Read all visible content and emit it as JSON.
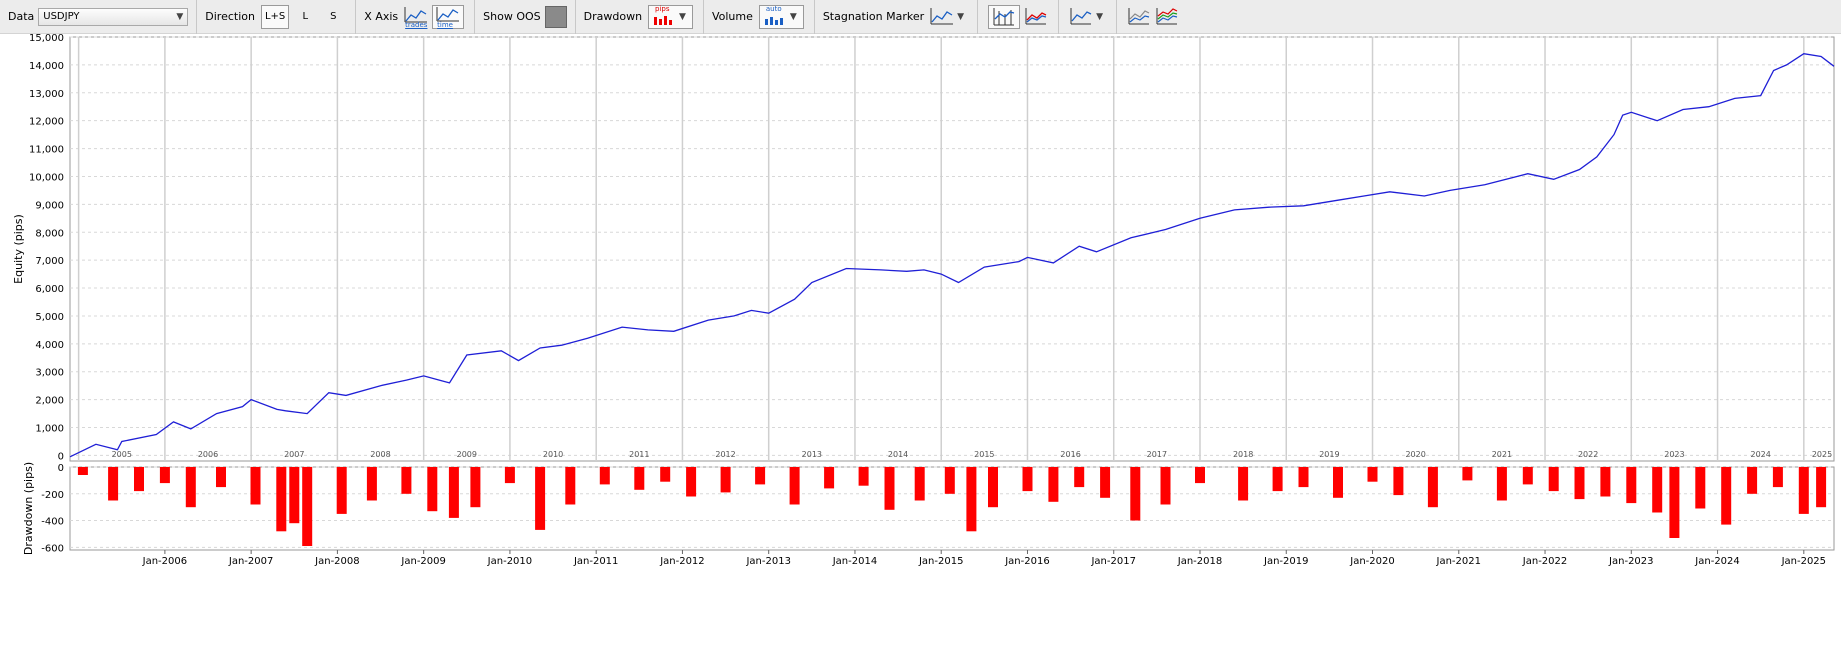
{
  "toolbar": {
    "data_label": "Data",
    "symbol": "USDJPY",
    "direction_label": "Direction",
    "direction_options": [
      "L+S",
      "L",
      "S"
    ],
    "xaxis_label": "X Axis",
    "xaxis_trades": "trades",
    "xaxis_time": "time",
    "showoos_label": "Show OOS",
    "drawdown_label": "Drawdown",
    "drawdown_unit": "pips",
    "volume_label": "Volume",
    "volume_mode": "auto",
    "stagnation_label": "Stagnation Marker"
  },
  "colors": {
    "equity": "#1f1fd6",
    "drawdown": "#ff0000",
    "grid": "#d8d8d8",
    "year_band": "#cfcfcf"
  },
  "chart_data": [
    {
      "type": "line",
      "ylabel": "Equity (pips)",
      "ylim": [
        -200,
        15000
      ],
      "yticks": [
        0,
        1000,
        2000,
        3000,
        4000,
        5000,
        6000,
        7000,
        8000,
        9000,
        10000,
        11000,
        12000,
        13000,
        14000,
        15000
      ],
      "ytick_labels": [
        "0",
        "1,000",
        "2,000",
        "3,000",
        "4,000",
        "5,000",
        "6,000",
        "7,000",
        "8,000",
        "9,000",
        "10,000",
        "11,000",
        "12,000",
        "13,000",
        "14,000",
        "15,000"
      ],
      "xlim": [
        2004.9,
        2025.35
      ],
      "year_labels": [
        "2005",
        "2006",
        "2007",
        "2008",
        "2009",
        "2010",
        "2011",
        "2012",
        "2013",
        "2014",
        "2015",
        "2016",
        "2017",
        "2018",
        "2019",
        "2020",
        "2021",
        "2022",
        "2023",
        "2024",
        "2025"
      ],
      "grid": true,
      "series": [
        {
          "x": [
            2004.9,
            2005.2,
            2005.45,
            2005.5,
            2005.9,
            2006.1,
            2006.3,
            2006.6,
            2006.9,
            2007.0,
            2007.3,
            2007.4,
            2007.65,
            2007.9,
            2008.1,
            2008.5,
            2008.8,
            2009.0,
            2009.3,
            2009.5,
            2009.9,
            2010.1,
            2010.35,
            2010.6,
            2010.9,
            2011.3,
            2011.6,
            2011.9,
            2012.3,
            2012.6,
            2012.8,
            2013.0,
            2013.3,
            2013.5,
            2013.9,
            2014.3,
            2014.6,
            2014.8,
            2015.0,
            2015.2,
            2015.5,
            2015.9,
            2016.0,
            2016.3,
            2016.6,
            2016.8,
            2017.2,
            2017.6,
            2018.0,
            2018.4,
            2018.8,
            2019.2,
            2019.6,
            2019.9,
            2020.2,
            2020.6,
            2020.9,
            2021.3,
            2021.8,
            2022.1,
            2022.4,
            2022.6,
            2022.8,
            2022.9,
            2023.0,
            2023.3,
            2023.6,
            2023.9,
            2024.2,
            2024.5,
            2024.65,
            2024.8,
            2025.0,
            2025.2,
            2025.35
          ],
          "y": [
            -50,
            400,
            200,
            500,
            750,
            1200,
            950,
            1500,
            1750,
            2000,
            1650,
            1600,
            1500,
            2250,
            2150,
            2500,
            2700,
            2850,
            2600,
            3600,
            3750,
            3400,
            3850,
            3950,
            4200,
            4600,
            4500,
            4450,
            4850,
            5000,
            5200,
            5100,
            5600,
            6200,
            6700,
            6650,
            6600,
            6650,
            6500,
            6200,
            6750,
            6950,
            7100,
            6900,
            7500,
            7300,
            7800,
            8100,
            8500,
            8800,
            8900,
            8950,
            9150,
            9300,
            9450,
            9300,
            9500,
            9700,
            10100,
            9900,
            10250,
            10700,
            11500,
            12200,
            12300,
            12000,
            12400,
            12500,
            12800,
            12900,
            13800,
            14000,
            14400,
            14300,
            13950
          ]
        }
      ]
    },
    {
      "type": "bar",
      "ylabel": "Drawdown (pips)",
      "ylim": [
        -620,
        0
      ],
      "yticks": [
        0,
        -200,
        -400,
        -600
      ],
      "ytick_labels": [
        "0",
        "-200",
        "-400",
        "-600"
      ],
      "x_tick_labels": [
        "Jan-2006",
        "Jan-2007",
        "Jan-2008",
        "Jan-2009",
        "Jan-2010",
        "Jan-2011",
        "Jan-2012",
        "Jan-2013",
        "Jan-2014",
        "Jan-2015",
        "Jan-2016",
        "Jan-2017",
        "Jan-2018",
        "Jan-2019",
        "Jan-2020",
        "Jan-2021",
        "Jan-2022",
        "Jan-2023",
        "Jan-2024",
        "Jan-2025"
      ],
      "grid": true,
      "series": [
        {
          "name": "Drawdown",
          "x": [
            2005.05,
            2005.4,
            2005.7,
            2006.0,
            2006.3,
            2006.65,
            2007.05,
            2007.35,
            2007.5,
            2007.65,
            2008.05,
            2008.4,
            2008.8,
            2009.1,
            2009.35,
            2009.6,
            2010.0,
            2010.35,
            2010.7,
            2011.1,
            2011.5,
            2011.8,
            2012.1,
            2012.5,
            2012.9,
            2013.3,
            2013.7,
            2014.1,
            2014.4,
            2014.75,
            2015.1,
            2015.35,
            2015.6,
            2016.0,
            2016.3,
            2016.6,
            2016.9,
            2017.25,
            2017.6,
            2018.0,
            2018.5,
            2018.9,
            2019.2,
            2019.6,
            2020.0,
            2020.3,
            2020.7,
            2021.1,
            2021.5,
            2021.8,
            2022.1,
            2022.4,
            2022.7,
            2023.0,
            2023.3,
            2023.5,
            2023.8,
            2024.1,
            2024.4,
            2024.7,
            2025.0,
            2025.2
          ],
          "y": [
            -60,
            -250,
            -180,
            -120,
            -300,
            -150,
            -280,
            -480,
            -420,
            -590,
            -350,
            -250,
            -200,
            -330,
            -380,
            -300,
            -120,
            -470,
            -280,
            -130,
            -170,
            -110,
            -220,
            -190,
            -130,
            -280,
            -160,
            -140,
            -320,
            -250,
            -200,
            -480,
            -300,
            -180,
            -260,
            -150,
            -230,
            -400,
            -280,
            -120,
            -250,
            -180,
            -150,
            -230,
            -110,
            -210,
            -300,
            -100,
            -250,
            -130,
            -180,
            -240,
            -220,
            -270,
            -340,
            -530,
            -310,
            -430,
            -200,
            -150,
            -350,
            -300
          ]
        }
      ]
    }
  ]
}
